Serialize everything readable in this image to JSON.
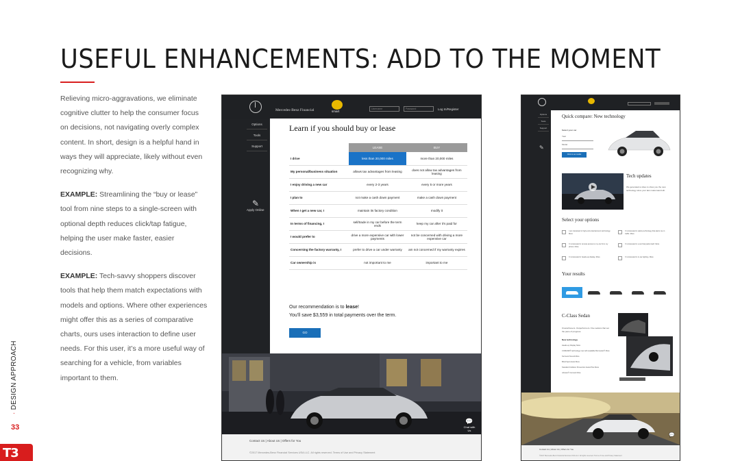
{
  "slide": {
    "title": "USEFUL ENHANCEMENTS: ADD TO THE MOMENT",
    "intro": "Relieving micro-aggravations, we eliminate cognitive clutter to help the consumer focus on decisions, not navigating overly complex content. In short, design is a helpful hand in ways they will appreciate, likely without even recognizing why.",
    "example1_label": "EXAMPLE:",
    "example1_text": " Streamlining the “buy or lease” tool from nine steps to a single-screen with optional depth reduces click/tap fatigue, helping the user make faster, easier decisions.",
    "example2_label": "EXAMPLE:",
    "example2_text": " Tech-savvy shoppers discover tools that help them match expectations with models and options. Where other experiences might offer this as a series of comparative charts, ours uses interaction to define user needs. For this user, it’s a more useful way of searching for a vehicle, from variables important to them.",
    "side_label": "DESIGN APPROACH",
    "side_dot": "·",
    "page_number": "33",
    "logo": "T3",
    "accent_color": "#d81d1d"
  },
  "mock1": {
    "brand": "Mercedes-Benz Financial",
    "smart_label": "smart",
    "username_placeholder": "Username",
    "password_placeholder": "Password",
    "login_label": "Log In/Register",
    "nav": [
      "Options",
      "Tools",
      "Support"
    ],
    "apply_label": "Apply Online",
    "heading": "Learn if you should buy or lease",
    "col_lease": "LEASE",
    "col_buy": "BUY",
    "rows": [
      {
        "label": "I drive",
        "lease": "less than 20,000 miles",
        "buy": "more than 20,000 miles"
      },
      {
        "label": "My personal/business situation",
        "lease": "allows tax advantages from leasing",
        "buy": "does not allow tax advantages from leasing"
      },
      {
        "label": "I enjoy driving a new car",
        "lease": "every 2-3 years",
        "buy": "every 5 or more years"
      },
      {
        "label": "I plan to",
        "lease": "not make a cash down payment",
        "buy": "make a cash down payment"
      },
      {
        "label": "When I get a new car, I",
        "lease": "maintain its factory condition",
        "buy": "modify it"
      },
      {
        "label": "In terms of financing, I",
        "lease": "sell/trade in my car before the term ends",
        "buy": "keep my car after it's paid for"
      },
      {
        "label": "I would prefer to",
        "lease": "drive a more expensive car with lower payments",
        "buy": "not be concerned with driving a more expensive car"
      },
      {
        "label": "Concerning the factory warranty, I",
        "lease": "prefer to drive a car under warranty",
        "buy": "am not concerned if my warranty expires"
      },
      {
        "label": "Car ownership is",
        "lease": "not important to me",
        "buy": "important to me"
      }
    ],
    "rec_line1": "Our recommendation is to ",
    "rec_strong": "lease",
    "rec_end": "!",
    "rec_line2": "You'll save $3,559 in total payments over the term.",
    "go_label": "GO",
    "chat_label": "Chat with Us",
    "footer_links": "Contact Us  |  About Us  |  Offers for You",
    "footer_copy": "©2017 Mercedes-Benz Financial Services USA LLC. All rights reserved.     Terms of Use and Privacy Statement"
  },
  "mock2": {
    "heading": "Quick compare: New technology",
    "select_car": "Select your car",
    "year_label": "Year",
    "model_label": "Model",
    "add_button": "Click to set model",
    "tech_heading": "Tech updates",
    "tech_text": "We generated a video to show you the new technology since your last model was built.",
    "options_heading": "Select your options",
    "options": [
      "I am interested in high-end entertainment technology. More",
      "I'm interested in safety technology that alerts me in traffic. More",
      "I'm interested in remote access to my car from my phone. More",
      "I'm interested in a car that parks itself. More",
      "I'm interested in heads-up display. More",
      "I'm interested in in-car lighting. More"
    ],
    "results_heading": "Your results",
    "model_heading": "C-Class Sedan",
    "model_text": "Overachievers. Outperformers. Five sedans that set the pace of progress.",
    "new_tech_label": "New technology",
    "tech_items": [
      "Heads-up Display More",
      "COMAND® technology now with available Burmester® More",
      "Surround Sound More",
      "Blind Spot Assist More",
      "Standard Collision Prevention Assist Plus More",
      "mbrace® Connect More"
    ],
    "nav": [
      "Options",
      "Tools",
      "Support"
    ],
    "footer_links": "Contact Us  |  About Us  |  Offers for You",
    "footer_copy": "©2017 Mercedes-Benz Financial Services USA LLC. All rights reserved.   Terms of Use and Privacy Statement"
  }
}
